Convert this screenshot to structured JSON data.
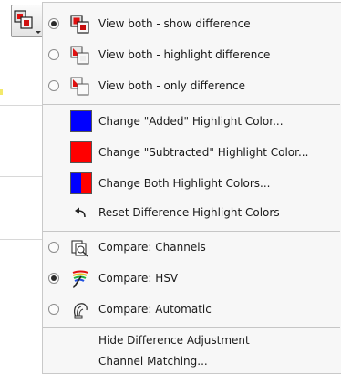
{
  "toolbar": {
    "icon": "view-both-icon"
  },
  "menu": {
    "view_items": [
      {
        "label": "View both - show difference",
        "selected": true,
        "icon": "view-both-show-icon"
      },
      {
        "label": "View both - highlight difference",
        "selected": false,
        "icon": "view-both-highlight-icon"
      },
      {
        "label": "View both - only difference",
        "selected": false,
        "icon": "view-both-only-icon"
      }
    ],
    "color_items": [
      {
        "label": "Change \"Added\" Highlight Color...",
        "swatch": "#0000ff"
      },
      {
        "label": "Change \"Subtracted\" Highlight Color...",
        "swatch": "#ff0000"
      },
      {
        "label": "Change Both Highlight Colors...",
        "swatch": [
          "#0000ff",
          "#ff0000"
        ]
      },
      {
        "label": "Reset Difference Highlight Colors",
        "icon": "reset-arrow-icon"
      }
    ],
    "compare_items": [
      {
        "label": "Compare: Channels",
        "selected": false,
        "icon": "channels-icon"
      },
      {
        "label": "Compare: HSV",
        "selected": true,
        "icon": "hsv-icon"
      },
      {
        "label": "Compare: Automatic",
        "selected": false,
        "icon": "automatic-icon"
      }
    ],
    "bottom_items": [
      {
        "label": "Hide Difference Adjustment"
      },
      {
        "label": "Channel Matching..."
      }
    ]
  }
}
